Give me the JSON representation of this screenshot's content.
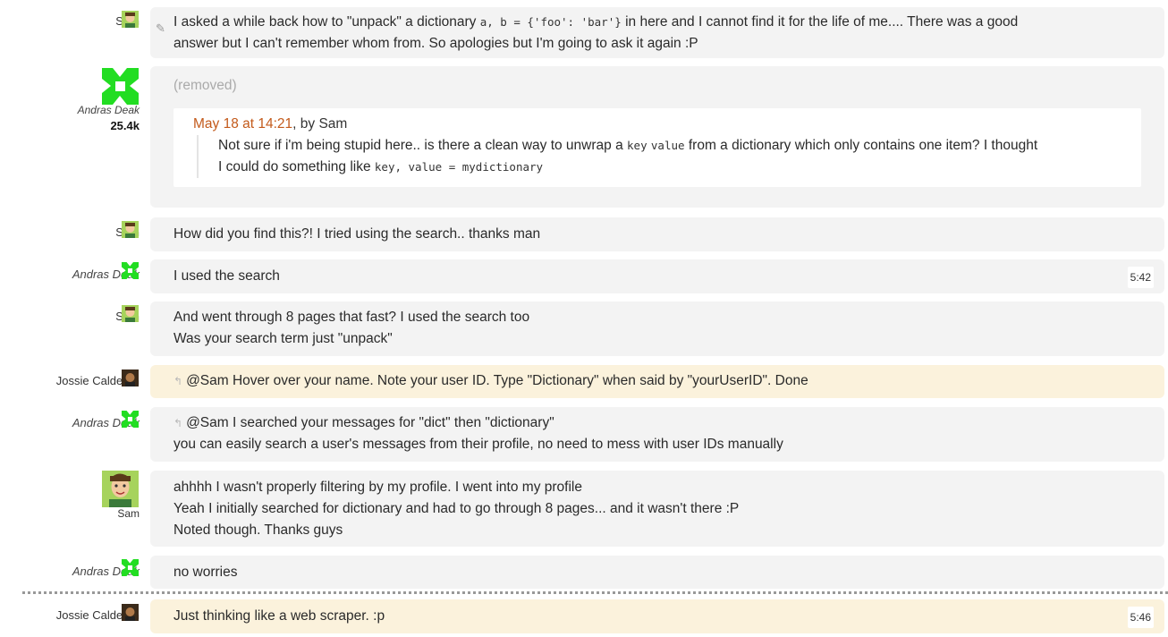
{
  "users": {
    "sam": "Sam",
    "andras": "Andras Deak",
    "andras_rep": "25.4k",
    "jossie": "Jossie Calderon"
  },
  "messages": {
    "m1": {
      "t1": "I asked a while back how to \"unpack\" a dictionary ",
      "c1": "a, b = {'foo': 'bar'}",
      "t2": " in here and I cannot find it for the life of me.... There was a good",
      "line2": "answer but I can't remember whom from. So apologies but I'm going to ask it again :P"
    },
    "m2": {
      "removed": "(removed)",
      "quote_date": "May 18 at 14:21",
      "quote_by": ", by Sam",
      "q1a": "Not sure if i'm being stupid here.. is there a clean way to unwrap a ",
      "q1c1": "key",
      "q1c2": "value",
      "q1b": " from a dictionary which only contains one item? I thought",
      "q2a": "I could do something like ",
      "q2c": "key, value = mydictionary"
    },
    "m3": "How did you find this?! I tried using the search.. thanks man",
    "m4": {
      "text": "I used the search",
      "time": "5:42"
    },
    "m5": {
      "l1": "And went through 8 pages that fast? I used the search too",
      "l2": "Was your search term just \"unpack\""
    },
    "m6": "@Sam Hover over your name. Note your user ID. Type \"Dictionary\" when said by \"yourUserID\". Done",
    "m7": {
      "l1": "@Sam I searched your messages for \"dict\" then \"dictionary\"",
      "l2": "you can easily search a user's messages from their profile, no need to mess with user IDs manually"
    },
    "m8": {
      "l1": "ahhhh I wasn't properly filtering by my profile. I went into my profile",
      "l2": "Yeah I initially searched for dictionary and had to go through 8 pages... and it wasn't there :P",
      "l3": "Noted though. Thanks guys"
    },
    "m9": "no worries",
    "m10": {
      "text": "Just thinking like a web scraper. :p",
      "time": "5:46"
    }
  },
  "colors": {
    "bubble": "#f3f3f3",
    "highlight": "#fbf2dc",
    "quote_date": "#c35a1b",
    "andras_avatar": "#22dd22"
  }
}
